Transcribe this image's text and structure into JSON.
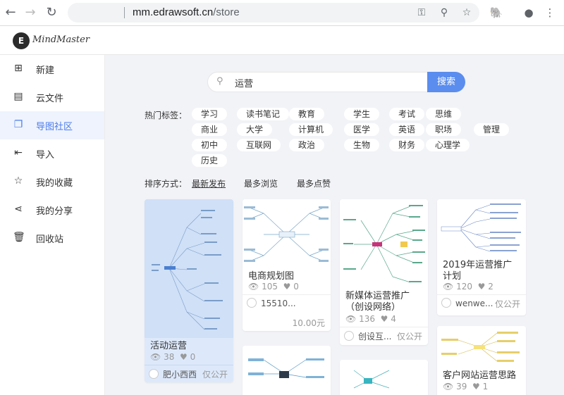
{
  "browser": {
    "url_domain": "mm.edrawsoft.cn",
    "url_path": "/store",
    "back_icon": "arrow-left",
    "forward_icon": "arrow-right",
    "reload_icon": "reload"
  },
  "app": {
    "logo_letter": "E",
    "logo_text": "MindMaster"
  },
  "sidebar": {
    "items": [
      {
        "label": "新建",
        "icon": "plus-square-icon",
        "glyph": "⊞"
      },
      {
        "label": "云文件",
        "icon": "cloud-file-icon",
        "glyph": "▤"
      },
      {
        "label": "导图社区",
        "icon": "community-icon",
        "glyph": "❐"
      },
      {
        "label": "导入",
        "icon": "import-icon",
        "glyph": "⇤"
      },
      {
        "label": "我的收藏",
        "icon": "star-icon",
        "glyph": "☆"
      },
      {
        "label": "我的分享",
        "icon": "share-icon",
        "glyph": "⋖"
      },
      {
        "label": "回收站",
        "icon": "trash-icon",
        "glyph": "🗑"
      }
    ],
    "active_index": 2,
    "accent": "#4b7bec"
  },
  "search": {
    "value": "运营",
    "button": "搜索"
  },
  "tags": {
    "label": "热门标签：",
    "rows": [
      [
        "学习",
        "读书笔记",
        "教育",
        "学生",
        "考试",
        "思维"
      ],
      [
        "商业",
        "大学",
        "计算机",
        "医学",
        "英语",
        "职场",
        "管理"
      ],
      [
        "初中",
        "互联网",
        "政治",
        "生物",
        "财务",
        "心理学"
      ],
      [
        "历史"
      ]
    ]
  },
  "sort": {
    "label": "排序方式：",
    "options": [
      "最新发布",
      "最多浏览",
      "最多点赞"
    ],
    "active_index": 0
  },
  "cards": [
    {
      "title": "活动运营",
      "views": "38",
      "likes": "0",
      "user": "肥小西西",
      "visibility": "仅公开"
    },
    {
      "title": "电商规划图",
      "views": "105",
      "likes": "0",
      "user": "15510...",
      "price": "10.00元"
    },
    {
      "title": "新媒体运营推广（创设网络）",
      "views": "136",
      "likes": "4",
      "user": "创设互...",
      "visibility": "仅公开"
    },
    {
      "title": "2019年运营推广计划",
      "views": "120",
      "likes": "2",
      "user": "wenwe...",
      "visibility": "仅公开"
    },
    {
      "title": "客户网站运营思路",
      "views": "39",
      "likes": "1"
    }
  ]
}
